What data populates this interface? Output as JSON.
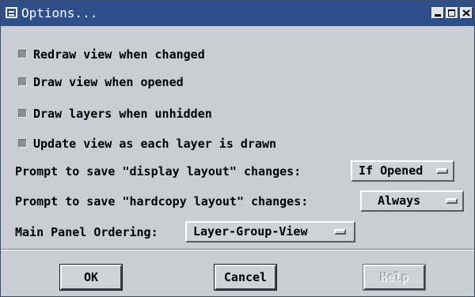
{
  "window": {
    "title": "Options...",
    "icon": "window-menu-icon",
    "controls": [
      "minimize-icon",
      "maximize-icon",
      "close-icon"
    ]
  },
  "checkboxes": [
    {
      "label": "Redraw view when changed",
      "checked": false
    },
    {
      "label": "Draw view when opened",
      "checked": false
    },
    {
      "label": "Draw layers when unhidden",
      "checked": false
    },
    {
      "label": "Update view as each layer is drawn",
      "checked": false
    }
  ],
  "options": {
    "display_prompt": {
      "label": "Prompt to save \"display layout\" changes:",
      "value": "If Opened"
    },
    "hardcopy_prompt": {
      "label": "Prompt to save \"hardcopy layout\" changes:",
      "value": "Always"
    },
    "panel_ordering": {
      "label": "Main Panel Ordering:",
      "value": "Layer-Group-View"
    }
  },
  "buttons": {
    "ok": "OK",
    "cancel": "Cancel",
    "help": "Help"
  },
  "colors": {
    "titlebar": "#2e4e8c",
    "panel": "#c8ced4"
  }
}
